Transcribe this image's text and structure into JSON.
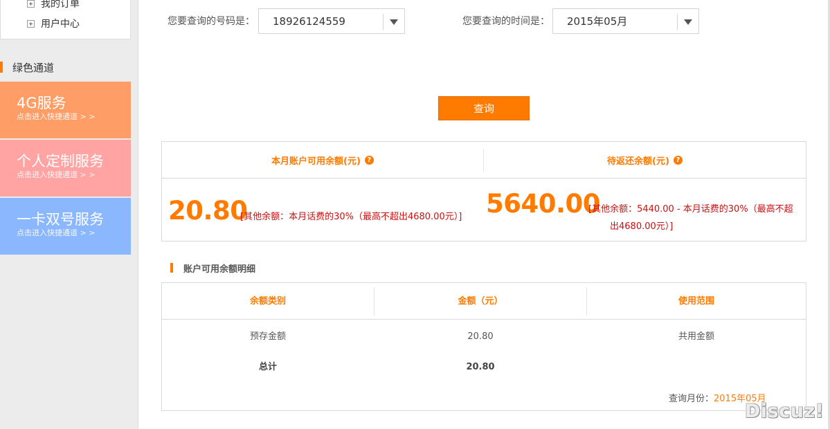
{
  "sidebar": {
    "sub_items": [
      {
        "label": "我的订单"
      },
      {
        "label": "用户中心"
      }
    ],
    "green_channel_title": "绿色通道",
    "services": [
      {
        "title": "4G服务",
        "subtitle": "点击进入快捷通道 > >",
        "color": "#ff9d66"
      },
      {
        "title": "个人定制服务",
        "subtitle": "点击进入快捷通道 > >",
        "color": "#ffa3a3"
      },
      {
        "title": "一卡双号服务",
        "subtitle": "点击进入快捷通道 > >",
        "color": "#8bb7ff"
      }
    ]
  },
  "query": {
    "number_label": "您要查询的号码是：",
    "number_value": "18926124559",
    "time_label": "您要查询的时间是：",
    "time_value": "2015年05月",
    "button_label": "查询"
  },
  "balance": {
    "available_header": "本月账户可用余额(元)",
    "pending_header": "待返还余额(元)",
    "help_glyph": "?",
    "available_amount": "20.80",
    "available_note": "[其他余额：本月话费的30%（最高不超出4680.00元）]",
    "pending_amount": "5640.00",
    "pending_note_line1": "[其他余额：5440.00 - 本月话费的30%（最高不超",
    "pending_note_line2": "出4680.00元）]"
  },
  "detail": {
    "title": "账户可用余额明细",
    "columns": [
      "余额类别",
      "金额（元）",
      "使用范围"
    ],
    "rows": [
      {
        "type": "预存金额",
        "amount": "20.80",
        "scope": "共用金额"
      }
    ],
    "total_label": "总计",
    "total_amount": "20.80",
    "month_label": "查询月份：",
    "month_value": "2015年05月"
  },
  "watermark": "Discuz!",
  "colors": {
    "accent": "#ff7b00",
    "note_red": "#c81010"
  }
}
